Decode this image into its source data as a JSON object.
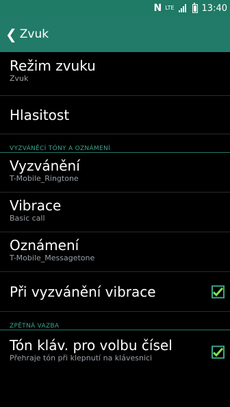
{
  "status": {
    "time": "13:40",
    "network": "LTE",
    "nfc": "N"
  },
  "header": {
    "title": "Zvuk"
  },
  "items": [
    {
      "label": "Režim zvuku",
      "sub": "Zvuk"
    },
    {
      "label": "Hlasitost"
    }
  ],
  "section1": "VYZVÁNĚCÍ TÓNY A OZNÁMENÍ",
  "items2": [
    {
      "label": "Vyzvánění",
      "sub": "T-Mobile_Ringtone"
    },
    {
      "label": "Vibrace",
      "sub": "Basic call"
    },
    {
      "label": "Oznámení",
      "sub": "T-Mobile_Messagetone"
    },
    {
      "label": "Při vyzvánění vibrace",
      "checked": true
    }
  ],
  "section2": "ZPĚTNÁ VAZBA",
  "items3": [
    {
      "label": "Tón kláv. pro volbu čísel",
      "sub": "Přehraje tón při klepnutí na klávesnici",
      "checked": true
    }
  ],
  "colors": {
    "accent": "#3aa58f",
    "actionbar": "#217b68",
    "check": "#7ee34a"
  }
}
